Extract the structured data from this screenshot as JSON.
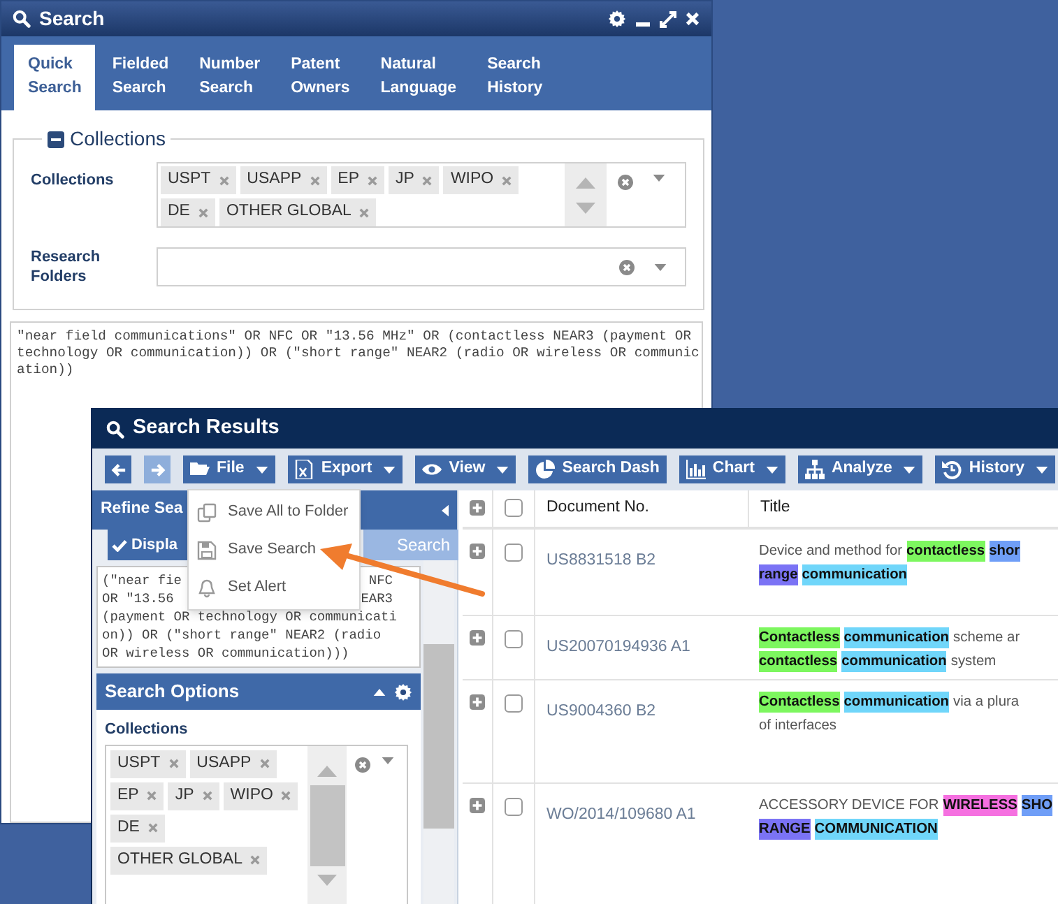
{
  "search_window": {
    "title": "Search",
    "tabs": [
      {
        "label": "Quick Search",
        "selected": true
      },
      {
        "label": "Fielded Search",
        "selected": false
      },
      {
        "label": "Number Search",
        "selected": false
      },
      {
        "label": "Patent Owners",
        "selected": false
      },
      {
        "label": "Natural Language",
        "selected": false
      },
      {
        "label": "Search History",
        "selected": false
      }
    ],
    "collections_section": {
      "legend": "Collections",
      "collections_label": "Collections",
      "collections": [
        "USPT",
        "USAPP",
        "EP",
        "JP",
        "WIPO",
        "DE",
        "OTHER GLOBAL"
      ],
      "research_folders_label": "Research Folders"
    },
    "query": "\"near field communications\" OR NFC OR \"13.56 MHz\" OR (contactless NEAR3 (payment OR technology OR communication)) OR (\"short range\" NEAR2 (radio OR wireless OR communication))"
  },
  "results_window": {
    "title": "Search Results",
    "nav": [
      {
        "disabled": false
      },
      {
        "disabled": true
      }
    ],
    "toolbar": [
      {
        "label": "File",
        "kind": "menu"
      },
      {
        "label": "Export",
        "kind": "menu"
      },
      {
        "label": "View",
        "kind": "menu"
      },
      {
        "label": "Search Dash",
        "kind": "button"
      },
      {
        "label": "Chart",
        "kind": "menu"
      },
      {
        "label": "Analyze",
        "kind": "menu"
      },
      {
        "label": "History",
        "kind": "menu"
      }
    ],
    "file_menu": [
      "Save All to Folder",
      "Save Search",
      "Set Alert"
    ],
    "refine_panel": {
      "title": "Refine Sea",
      "display_button": "Displa",
      "search_button": "Search",
      "query_lines": [
        [
          "(\"near fie",
          "NFC"
        ],
        [
          "OR \"13.56",
          "EAR3"
        ],
        [
          "(payment OR technology OR communicati"
        ],
        [
          "on)) OR (\"short range\" NEAR2 (radio"
        ],
        [
          "OR wireless OR communication)))"
        ]
      ]
    },
    "search_options": {
      "title": "Search Options",
      "collections_label": "Collections",
      "collections": [
        "USPT",
        "USAPP",
        "EP",
        "JP",
        "WIPO",
        "DE",
        "OTHER GLOBAL"
      ]
    },
    "table": {
      "columns": [
        "Document No.",
        "Title"
      ],
      "header_checked": false,
      "rows": [
        {
          "doc_no": "US8831518 B2",
          "checked": false,
          "title_lines": [
            [
              {
                "text": "Device and method for"
              },
              {
                "text": "contactless",
                "color": "#7df75f"
              },
              {
                "text": "shor",
                "color": "#6f9ef7"
              }
            ],
            [
              {
                "text": "range",
                "color": "#7b73f5"
              },
              {
                "text": "communication",
                "color": "#70d6fa"
              }
            ]
          ]
        },
        {
          "doc_no": "US20070194936 A1",
          "checked": false,
          "title_lines": [
            [
              {
                "text": "Contactless",
                "color": "#7df75f"
              },
              {
                "text": "communication",
                "color": "#70d6fa"
              },
              {
                "text": "scheme ar"
              }
            ],
            [
              {
                "text": "contactless",
                "color": "#7df75f"
              },
              {
                "text": "communication",
                "color": "#70d6fa"
              },
              {
                "text": "system"
              }
            ]
          ]
        },
        {
          "doc_no": "US9004360 B2",
          "checked": false,
          "title_lines": [
            [
              {
                "text": "Contactless",
                "color": "#7df75f"
              },
              {
                "text": "communication",
                "color": "#70d6fa"
              },
              {
                "text": "via a plura"
              }
            ],
            [
              {
                "text": "of interfaces"
              }
            ]
          ]
        },
        {
          "doc_no": "WO/2014/109680 A1",
          "checked": false,
          "title_lines": [
            [
              {
                "text": "ACCESSORY DEVICE FOR"
              },
              {
                "text": "WIRELESS",
                "color": "#f570e0"
              },
              {
                "text": "SHO",
                "color": "#6f9ef7"
              }
            ],
            [
              {
                "text": "RANGE",
                "color": "#7b73f5"
              },
              {
                "text": "COMMUNICATION",
                "color": "#70d6fa"
              }
            ]
          ]
        }
      ]
    }
  }
}
